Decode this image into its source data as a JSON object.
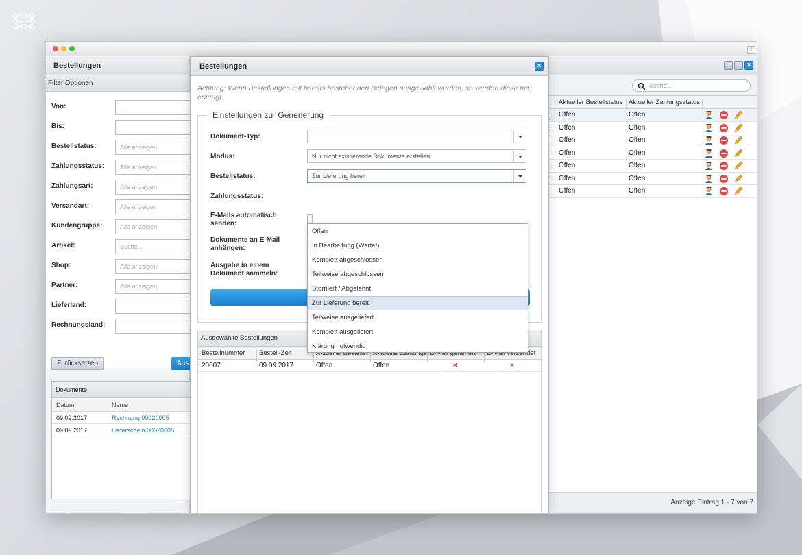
{
  "left_panel": {
    "title": "Bestellungen",
    "filter_header": "Filter Optionen",
    "filters": [
      {
        "label": "Von:",
        "value": "",
        "placeholder": ""
      },
      {
        "label": "Bis:",
        "value": "",
        "placeholder": ""
      },
      {
        "label": "Bestellstatus:",
        "value": "",
        "placeholder": "Alle anzeigen"
      },
      {
        "label": "Zahlungsstatus:",
        "value": "",
        "placeholder": "Alle anzeigen"
      },
      {
        "label": "Zahlungsart:",
        "value": "",
        "placeholder": "Alle anzeigen"
      },
      {
        "label": "Versandart:",
        "value": "",
        "placeholder": "Alle anzeigen"
      },
      {
        "label": "Kundengruppe:",
        "value": "",
        "placeholder": "Alle anzeigen"
      },
      {
        "label": "Artikel:",
        "value": "",
        "placeholder": "Suche..."
      },
      {
        "label": "Shop:",
        "value": "",
        "placeholder": "Alle anzeigen"
      },
      {
        "label": "Partner:",
        "value": "",
        "placeholder": "Alle anzeigen"
      },
      {
        "label": "Lieferland:",
        "value": "",
        "placeholder": ""
      },
      {
        "label": "Rechnungsland:",
        "value": "",
        "placeholder": ""
      }
    ],
    "reset_label": "Zurücksetzen",
    "apply_label": "Aus",
    "documents": {
      "title": "Dokumente",
      "columns": [
        "Datum",
        "Name"
      ],
      "rows": [
        {
          "date": "09.09.2017",
          "name": "Rechnung 00020005"
        },
        {
          "date": "09.09.2017",
          "name": "Lieferschein 00020005"
        }
      ]
    }
  },
  "right_panel": {
    "search_placeholder": "Suche...",
    "columns": [
      "Aktueller Bestellstatus",
      "Aktueller Zahlungsstatus"
    ],
    "rows": [
      {
        "order_status": "Offen",
        "payment_status": "Offen"
      },
      {
        "order_status": "Offen",
        "payment_status": "Offen"
      },
      {
        "order_status": "Offen",
        "payment_status": "Offen"
      },
      {
        "order_status": "Offen",
        "payment_status": "Offen"
      },
      {
        "order_status": "Offen",
        "payment_status": "Offen"
      },
      {
        "order_status": "Offen",
        "payment_status": "Offen"
      },
      {
        "order_status": "Offen",
        "payment_status": "Offen"
      }
    ],
    "row_dot": ".",
    "footer": "Anzeige Eintrag 1 - 7 von 7",
    "action_icons": [
      "user-icon",
      "delete-icon",
      "edit-pencil-icon"
    ]
  },
  "modal": {
    "title": "Bestellungen",
    "close_symbol": "×",
    "warning": "Achtung: Wenn Bestellungen mit bereits bestehenden Belegen ausgewählt wurden, so werden diese neu erzeugt.",
    "settings_legend": "Einstellungen zur Generierung",
    "fields": {
      "document_type": {
        "label": "Dokument-Typ:",
        "value": ""
      },
      "mode": {
        "label": "Modus:",
        "value": "Nur nicht existierende Dokumente erstellen"
      },
      "order_status": {
        "label": "Bestellstatus:",
        "value": "Zur Lieferung bereit"
      },
      "payment_status": {
        "label": "Zahlungsstatus:"
      },
      "auto_mail": {
        "label_line1": "E-Mails automatisch",
        "label_line2": "senden:"
      },
      "attach_docs": {
        "label_line1": "Dokumente an E-Mail",
        "label_line2": "anhängen:"
      },
      "collect_output": {
        "label_line1": "Ausgabe in einem",
        "label_line2": "Dokument sammeln:"
      }
    },
    "dropdown_options": [
      "Offen",
      "In Bearbeitung (Wartet)",
      "Komplett abgeschlossen",
      "Teilweise abgeschlossen",
      "Storniert / Abgelehnt",
      "Zur Lieferung bereit",
      "Teilweise ausgeliefert",
      "Komplett ausgeliefert",
      "Klärung notwendig"
    ],
    "dropdown_selected_index": 5,
    "selected_orders": {
      "title": "Ausgewählte Bestellungen",
      "columns": [
        "Bestellnummer",
        "Bestell-Zeit",
        "Aktueller Bestellst",
        "Aktueller Zahlungs",
        "E-Mail generiert",
        "E-Mail versendet"
      ],
      "rows": [
        {
          "number": "20007",
          "time": "09.09.2017",
          "order_status": "Offen",
          "payment_status": "Offen",
          "mail_generated": "×",
          "mail_sent": "×"
        }
      ]
    }
  },
  "colors": {
    "accent_blue": "#1c7fd1",
    "link_blue": "#1d7fd0",
    "x_red": "#d8262c",
    "selected_row": "#dde7f3"
  }
}
